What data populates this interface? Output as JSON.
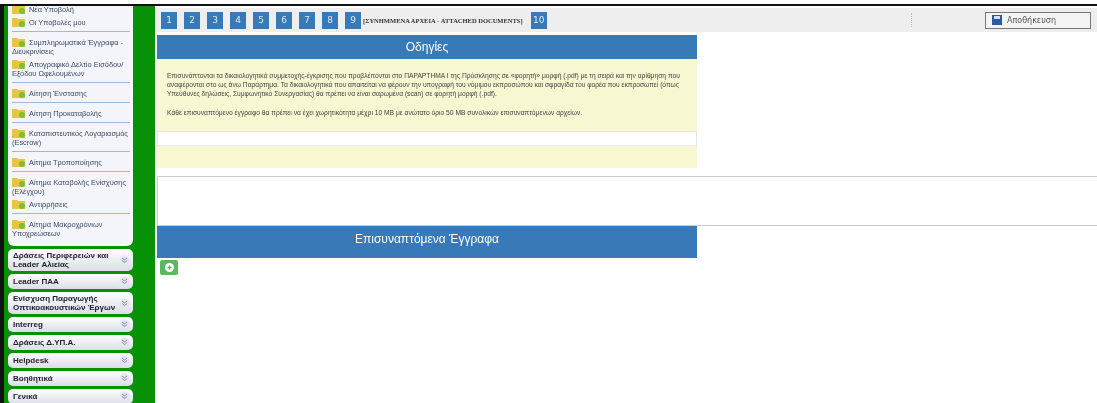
{
  "sidebar": {
    "menu_groups": [
      {
        "items": [
          "Νέα Υποβολή",
          "Οι Υποβολές μου"
        ]
      },
      {
        "items": [
          "Συμπληρωματικά Έγγραφα - Διευκρινίσεις",
          "Απογραφικό Δελτίο Εισόδου/ Εξόδου Ωφελουμένων"
        ]
      },
      {
        "items": [
          "Αίτηση Ένστασης"
        ]
      },
      {
        "items": [
          "Αίτηση Προκαταβολής"
        ]
      },
      {
        "items": [
          "Καταπιστευτικός Λογαριασμός (Escrow)"
        ]
      },
      {
        "items": [
          "Αίτημα Τροποποίησης"
        ]
      },
      {
        "items": [
          "Αίτημα Καταβολής Ενίσχυσης (Ελέγχου)",
          "Αντιρρήσεις"
        ]
      },
      {
        "items": [
          "Αίτημα Μακροχρόνιων Υποχρεώσεων"
        ]
      }
    ],
    "sections": [
      {
        "label": "Δράσεις Περιφερειών και Leader Αλιείας",
        "expanded": false
      },
      {
        "label": "Leader ΠΑΑ",
        "expanded": false
      },
      {
        "label": "Ενίσχυση Παραγωγής Οπτικοακουστικών Έργων",
        "expanded": false
      },
      {
        "label": "Interreg",
        "expanded": false
      },
      {
        "label": "Δράσεις Δ.ΥΠ.Α.",
        "expanded": false
      },
      {
        "label": "Helpdesk",
        "expanded": false
      },
      {
        "label": "Βοηθητικά",
        "expanded": false
      },
      {
        "label": "Γενικά",
        "expanded": false
      }
    ]
  },
  "steps": [
    {
      "label": "1"
    },
    {
      "label": "2"
    },
    {
      "label": "3"
    },
    {
      "label": "4"
    },
    {
      "label": "5"
    },
    {
      "label": "6"
    },
    {
      "label": "7"
    },
    {
      "label": "8"
    },
    {
      "label": "9",
      "caption": "[ΣΥΝΗΜΜΕΝΑ ΑΡΧΕΙΑ - ATTACHED DOCUMENTS]"
    },
    {
      "label": "10"
    }
  ],
  "save_button": "Αποθήκευση",
  "instructions": {
    "title": "Οδηγίες",
    "paragraphs": [
      "Επισυνάπτονται τα δικαιολογητικά συμμετοχής-έγκρισης που προβλέπονται στο ΠΑΡΑΡΤΗΜΑ Ι της Πρόσκλησης σε «φορητή» μορφή (.pdf) με τη σειρά και την αρίθμηση που αναφέρονται στο ως άνω Παράρτημα. Τα δικαιολογητικά που απαιτείται να φέρουν την υπογραφή του νόμιμου εκπροσώπου και σφραγίδα του φορέα που εκπροσωπεί (όπως Υπεύθυνες δηλώσεις, Συμφωνητικό Συνεργασίας) θα πρέπει να είναι σαρωμένα (scan) σε φορητή μορφή (.pdf).",
      "Κάθε επισυναπτόμενο έγγραφο θα πρέπει να έχει χωρητικότητα μέχρι 10 MB με ανώτατο όριο 50 MB συνολικών επισυναπτόμενων αρχείων."
    ]
  },
  "attachments": {
    "title": "Επισυναπτόμενα Έγγραφα"
  }
}
